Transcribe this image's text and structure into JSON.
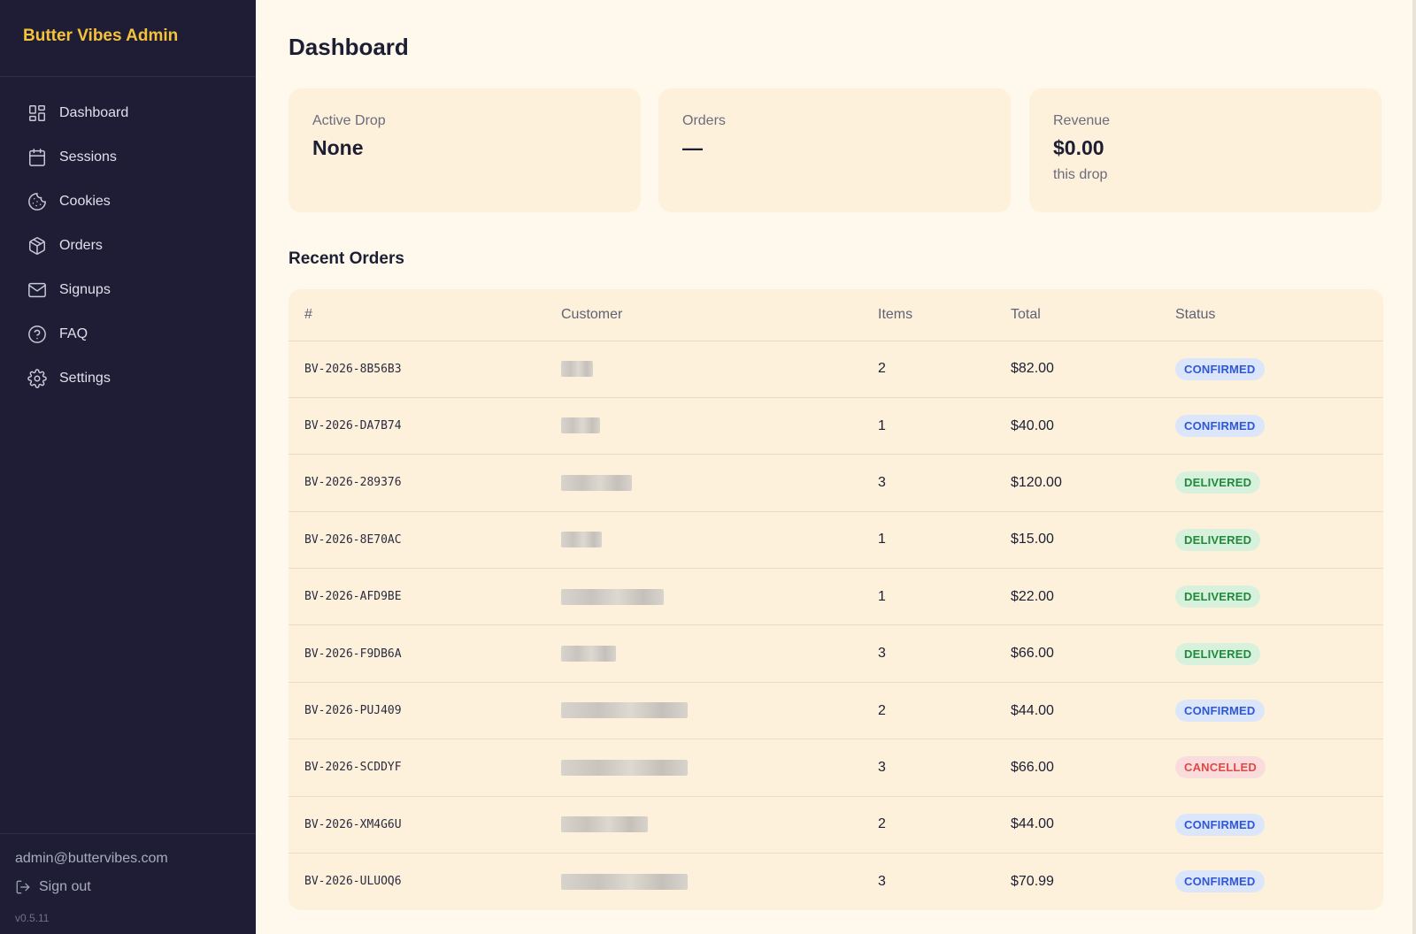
{
  "brand": {
    "title": "Butter Vibes Admin",
    "accent": "#f5c23c"
  },
  "sidebar": {
    "items": [
      {
        "label": "Dashboard",
        "icon": "dashboard-icon"
      },
      {
        "label": "Sessions",
        "icon": "calendar-icon"
      },
      {
        "label": "Cookies",
        "icon": "cookie-icon"
      },
      {
        "label": "Orders",
        "icon": "box-icon"
      },
      {
        "label": "Signups",
        "icon": "mail-icon"
      },
      {
        "label": "FAQ",
        "icon": "help-circle-icon"
      },
      {
        "label": "Settings",
        "icon": "gear-icon"
      }
    ],
    "user_email": "admin@buttervibes.com",
    "signout_label": "Sign out",
    "version": "v0.5.11"
  },
  "main": {
    "title": "Dashboard",
    "cards": [
      {
        "label": "Active Drop",
        "value": "None",
        "sub": ""
      },
      {
        "label": "Orders",
        "value": "—",
        "sub": ""
      },
      {
        "label": "Revenue",
        "value": "$0.00",
        "sub": "this drop"
      }
    ],
    "recent_orders": {
      "title": "Recent Orders",
      "columns": [
        "#",
        "Customer",
        "Items",
        "Total",
        "Status"
      ],
      "rows": [
        {
          "id": "BV-2026-8B56B3",
          "items": "2",
          "total": "$82.00",
          "status": "CONFIRMED"
        },
        {
          "id": "BV-2026-DA7B74",
          "items": "1",
          "total": "$40.00",
          "status": "CONFIRMED"
        },
        {
          "id": "BV-2026-289376",
          "items": "3",
          "total": "$120.00",
          "status": "DELIVERED"
        },
        {
          "id": "BV-2026-8E70AC",
          "items": "1",
          "total": "$15.00",
          "status": "DELIVERED"
        },
        {
          "id": "BV-2026-AFD9BE",
          "items": "1",
          "total": "$22.00",
          "status": "DELIVERED"
        },
        {
          "id": "BV-2026-F9DB6A",
          "items": "3",
          "total": "$66.00",
          "status": "DELIVERED"
        },
        {
          "id": "BV-2026-PUJ409",
          "items": "2",
          "total": "$44.00",
          "status": "CONFIRMED"
        },
        {
          "id": "BV-2026-SCDDYF",
          "items": "3",
          "total": "$66.00",
          "status": "CANCELLED"
        },
        {
          "id": "BV-2026-XM4G6U",
          "items": "2",
          "total": "$44.00",
          "status": "CONFIRMED"
        },
        {
          "id": "BV-2026-ULUOQ6",
          "items": "3",
          "total": "$70.99",
          "status": "CONFIRMED"
        }
      ]
    }
  },
  "colors": {
    "sidebar_bg": "#1e1d35",
    "page_bg": "#fef9ec",
    "card_bg": "#fdf1dc",
    "confirmed": "#2f57d6",
    "delivered": "#1f8a3c",
    "cancelled": "#e04848"
  }
}
